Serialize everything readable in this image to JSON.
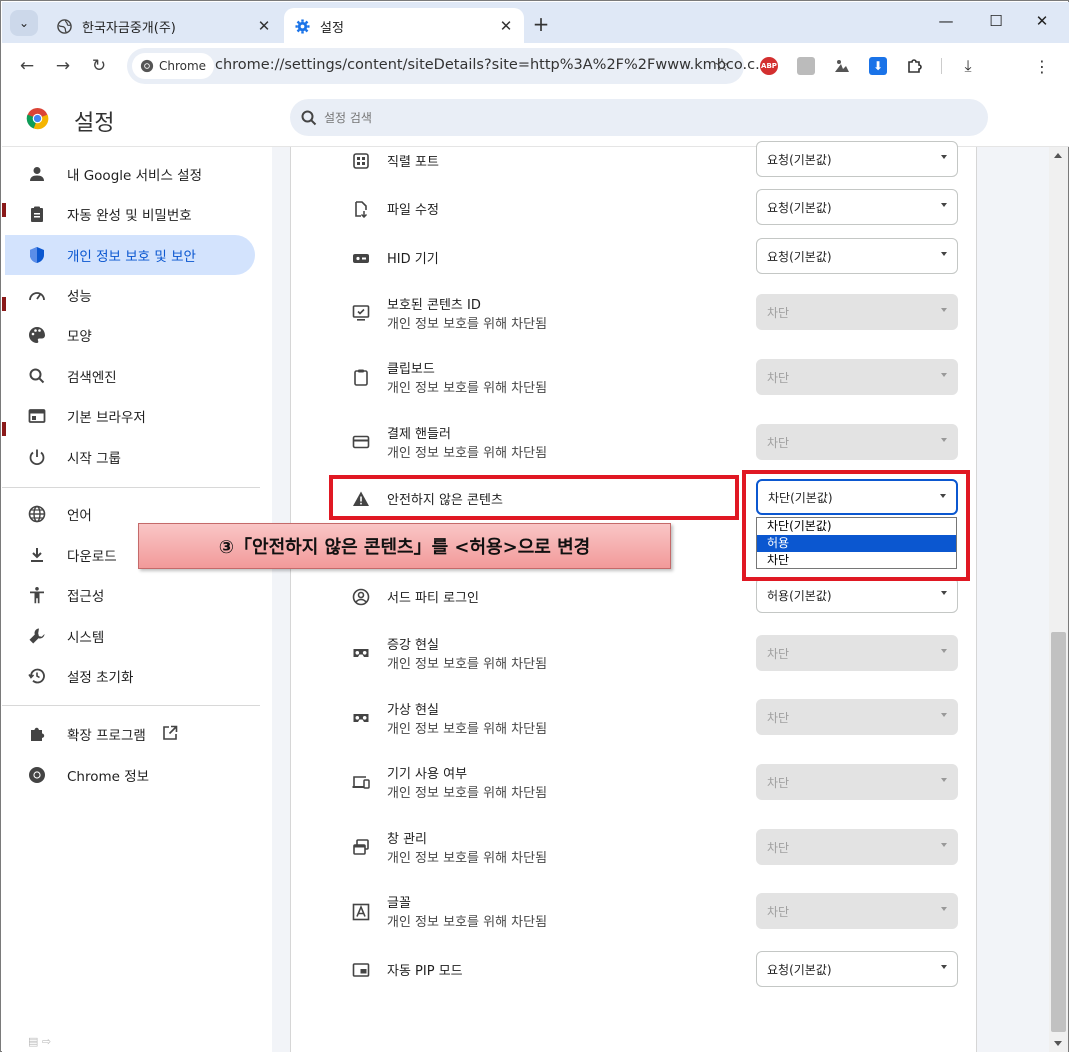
{
  "tabs": [
    {
      "title": "한국자금중개(주)",
      "active": false
    },
    {
      "title": "설정",
      "active": true
    }
  ],
  "omnibox": {
    "chip": "Chrome",
    "url": "chrome://settings/content/siteDetails?site=http%3A%2F%2Fwww.kmbco.c..."
  },
  "extensions": {
    "abp": "ABP"
  },
  "header": {
    "title": "설정",
    "search_placeholder": "설정 검색"
  },
  "sidebar": {
    "items": [
      {
        "label": "내 Google 서비스 설정",
        "icon": "person-icon",
        "selected": false
      },
      {
        "label": "자동 완성 및 비밀번호",
        "icon": "clipboard-icon",
        "selected": false
      },
      {
        "label": "개인 정보 보호 및 보안",
        "icon": "shield-icon",
        "selected": true
      },
      {
        "label": "성능",
        "icon": "gauge-icon",
        "selected": false
      },
      {
        "label": "모양",
        "icon": "palette-icon",
        "selected": false
      },
      {
        "label": "검색엔진",
        "icon": "search-icon",
        "selected": false
      },
      {
        "label": "기본 브라우저",
        "icon": "browser-window-icon",
        "selected": false
      },
      {
        "label": "시작 그룹",
        "icon": "power-icon",
        "selected": false
      },
      {
        "label": "언어",
        "icon": "globe-icon",
        "selected": false
      },
      {
        "label": "다운로드",
        "icon": "download-icon",
        "selected": false
      },
      {
        "label": "접근성",
        "icon": "accessibility-icon",
        "selected": false
      },
      {
        "label": "시스템",
        "icon": "wrench-icon",
        "selected": false
      },
      {
        "label": "설정 초기화",
        "icon": "history-icon",
        "selected": false
      },
      {
        "label": "확장 프로그램",
        "icon": "puzzle-icon",
        "selected": false
      },
      {
        "label": "Chrome 정보",
        "icon": "chrome-icon",
        "selected": false
      }
    ]
  },
  "permissions": [
    {
      "title": "직렬 포트",
      "subtitle": "",
      "value": "요청(기본값)",
      "disabled": false,
      "icon": "serial-port-icon"
    },
    {
      "title": "파일 수정",
      "subtitle": "",
      "value": "요청(기본값)",
      "disabled": false,
      "icon": "file-edit-icon"
    },
    {
      "title": "HID 기기",
      "subtitle": "",
      "value": "요청(기본값)",
      "disabled": false,
      "icon": "hid-device-icon"
    },
    {
      "title": "보호된 콘텐츠 ID",
      "subtitle": "개인 정보 보호를 위해 차단됨",
      "value": "차단",
      "disabled": true,
      "icon": "protected-content-icon"
    },
    {
      "title": "클립보드",
      "subtitle": "개인 정보 보호를 위해 차단됨",
      "value": "차단",
      "disabled": true,
      "icon": "clipboard-icon"
    },
    {
      "title": "결제 핸들러",
      "subtitle": "개인 정보 보호를 위해 차단됨",
      "value": "차단",
      "disabled": true,
      "icon": "credit-card-icon"
    },
    {
      "title": "안전하지 않은 콘텐츠",
      "subtitle": "",
      "value": "차단(기본값)",
      "disabled": false,
      "icon": "warning-icon",
      "focused": true
    },
    {
      "title": "서드 파티 로그인",
      "subtitle": "",
      "value": "허용(기본값)",
      "disabled": false,
      "icon": "account-circle-icon"
    },
    {
      "title": "증강 현실",
      "subtitle": "개인 정보 보호를 위해 차단됨",
      "value": "차단",
      "disabled": true,
      "icon": "vr-headset-icon"
    },
    {
      "title": "가상 현실",
      "subtitle": "개인 정보 보호를 위해 차단됨",
      "value": "차단",
      "disabled": true,
      "icon": "vr-headset-icon"
    },
    {
      "title": "기기 사용 여부",
      "subtitle": "개인 정보 보호를 위해 차단됨",
      "value": "차단",
      "disabled": true,
      "icon": "devices-icon"
    },
    {
      "title": "창 관리",
      "subtitle": "개인 정보 보호를 위해 차단됨",
      "value": "차단",
      "disabled": true,
      "icon": "window-management-icon"
    },
    {
      "title": "글꼴",
      "subtitle": "개인 정보 보호를 위해 차단됨",
      "value": "차단",
      "disabled": true,
      "icon": "font-icon"
    },
    {
      "title": "자동 PIP 모드",
      "subtitle": "",
      "value": "요청(기본값)",
      "disabled": false,
      "icon": "pip-icon"
    }
  ],
  "dropdown": {
    "options": [
      "차단(기본값)",
      "허용",
      "차단"
    ],
    "highlighted": "허용"
  },
  "callout": {
    "text": "③「안전하지 않은 콘텐츠」를 <허용>으로 변경"
  },
  "colors": {
    "accent": "#0b57d0",
    "annotation_red": "#e01823",
    "selected_nav_bg": "#d3e3fd"
  }
}
